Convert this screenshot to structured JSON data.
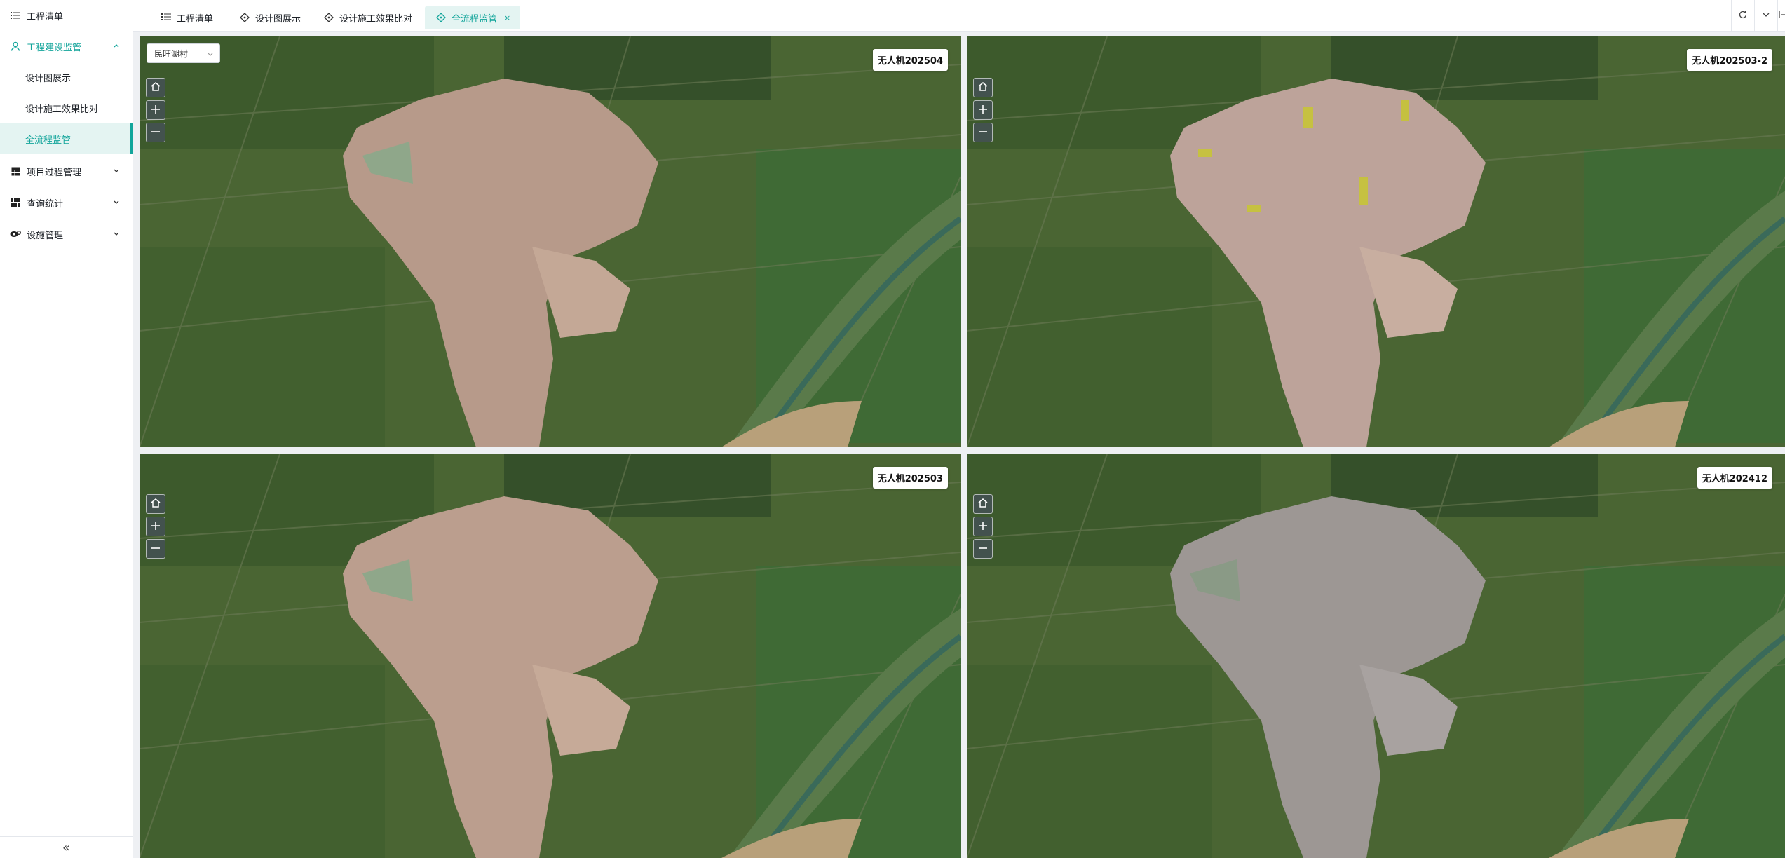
{
  "sidebar": {
    "items": [
      {
        "label": "工程清单",
        "icon": "list-icon"
      },
      {
        "label": "工程建设监管",
        "icon": "user-icon",
        "expanded": true
      },
      {
        "label": "设计图展示"
      },
      {
        "label": "设计施工效果比对"
      },
      {
        "label": "全流程监管",
        "active": true
      },
      {
        "label": "项目过程管理",
        "icon": "table-icon"
      },
      {
        "label": "查询统计",
        "icon": "grid-icon"
      },
      {
        "label": "设施管理",
        "icon": "settings-eye-icon"
      }
    ],
    "collapse_label": "«"
  },
  "tabs": [
    {
      "label": "工程清单",
      "icon": "list-icon"
    },
    {
      "label": "设计图展示",
      "icon": "diamond-icon"
    },
    {
      "label": "设计施工效果比对",
      "icon": "diamond-icon"
    },
    {
      "label": "全流程监管",
      "icon": "diamond-icon",
      "active": true,
      "close": "×"
    }
  ],
  "tools": [
    "refresh-icon",
    "expand-icon",
    "fullscreen-icon"
  ],
  "village_select": {
    "value": "民旺湖村"
  },
  "panels": [
    {
      "label": "无人机202504"
    },
    {
      "label": "无人机202503-2"
    },
    {
      "label": "无人机202503"
    },
    {
      "label": "无人机202412"
    }
  ],
  "colors": {
    "accent": "#13a59b",
    "active_bg": "#e4f4f2"
  }
}
